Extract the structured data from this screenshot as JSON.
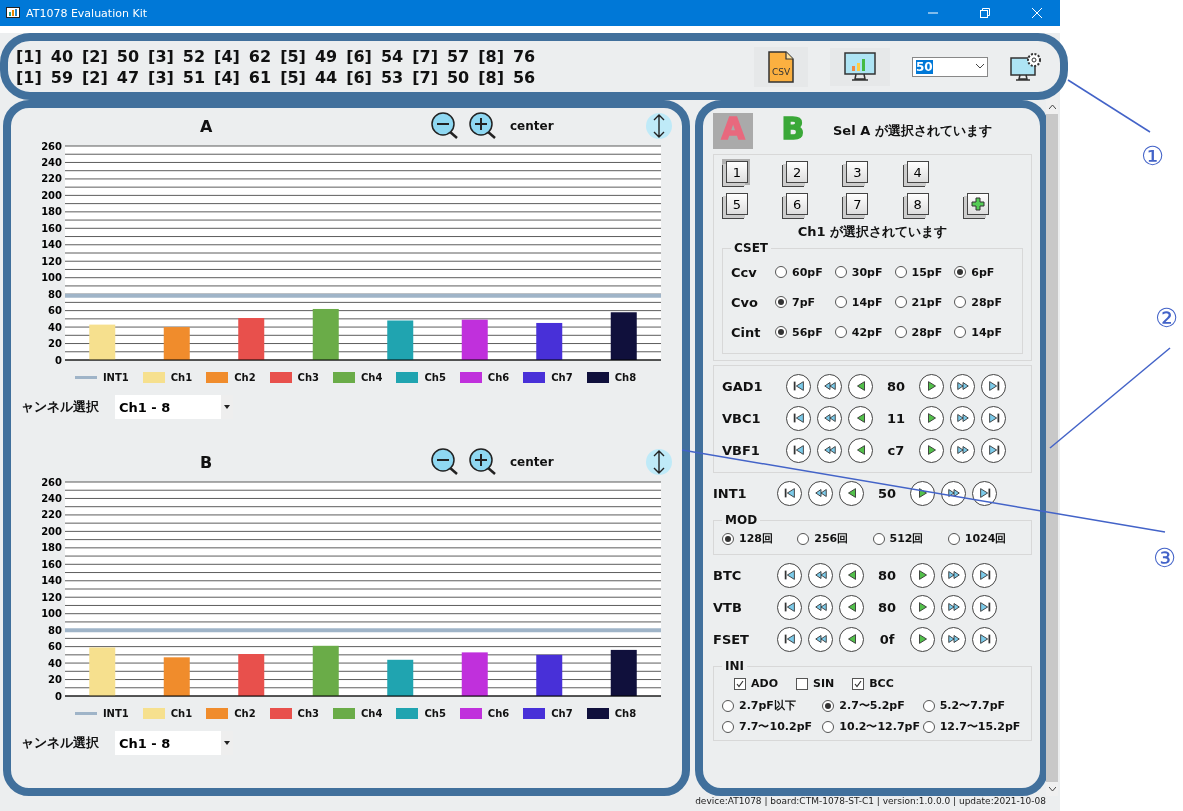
{
  "window": {
    "title": "AT1078 Evaluation Kit"
  },
  "readings": [
    {
      "pairs": [
        {
          "channel": "[1]",
          "value": "40"
        },
        {
          "channel": "[2]",
          "value": "50"
        },
        {
          "channel": "[3]",
          "value": "52"
        },
        {
          "channel": "[4]",
          "value": "62"
        },
        {
          "channel": "[5]",
          "value": "49"
        },
        {
          "channel": "[6]",
          "value": "54"
        },
        {
          "channel": "[7]",
          "value": "57"
        },
        {
          "channel": "[8]",
          "value": "76"
        }
      ]
    },
    {
      "pairs": [
        {
          "channel": "[1]",
          "value": "59"
        },
        {
          "channel": "[2]",
          "value": "47"
        },
        {
          "channel": "[3]",
          "value": "51"
        },
        {
          "channel": "[4]",
          "value": "61"
        },
        {
          "channel": "[5]",
          "value": "44"
        },
        {
          "channel": "[6]",
          "value": "53"
        },
        {
          "channel": "[7]",
          "value": "50"
        },
        {
          "channel": "[8]",
          "value": "56"
        }
      ]
    }
  ],
  "toolbar": {
    "csv_label": "CSV",
    "interval": "50"
  },
  "charts": [
    {
      "title": "A",
      "zoom_label": "center",
      "channel_label": "ャンネル選択",
      "channel_select": "Ch1 - 8",
      "chart_data": {
        "type": "bar",
        "grid": true,
        "ylim": [
          0,
          260
        ],
        "yticks": [
          0,
          20,
          40,
          60,
          80,
          100,
          120,
          140,
          160,
          180,
          200,
          220,
          240,
          260
        ],
        "ref_lines": [
          {
            "axis": "y",
            "value": 78,
            "label": "INT1",
            "color": "#9fb4c8"
          }
        ],
        "series": [
          {
            "name": "Ch1",
            "color": "#f6e08e",
            "values": [
              43,
              null,
              null,
              null,
              null,
              null,
              null,
              null
            ]
          },
          {
            "name": "Ch2",
            "color": "#f08c2c",
            "values": [
              null,
              40,
              null,
              null,
              null,
              null,
              null,
              null
            ]
          },
          {
            "name": "Ch3",
            "color": "#e8504c",
            "values": [
              null,
              null,
              51,
              null,
              null,
              null,
              null,
              null
            ]
          },
          {
            "name": "Ch4",
            "color": "#6aac48",
            "values": [
              null,
              null,
              null,
              62,
              null,
              null,
              null,
              null
            ]
          },
          {
            "name": "Ch5",
            "color": "#20a4b0",
            "values": [
              null,
              null,
              null,
              null,
              48,
              null,
              null,
              null
            ]
          },
          {
            "name": "Ch6",
            "color": "#c030dc",
            "values": [
              null,
              null,
              null,
              null,
              null,
              49,
              null,
              null
            ]
          },
          {
            "name": "Ch7",
            "color": "#4830d8",
            "values": [
              null,
              null,
              null,
              null,
              null,
              null,
              45,
              null
            ]
          },
          {
            "name": "Ch8",
            "color": "#10103c",
            "values": [
              null,
              null,
              null,
              null,
              null,
              null,
              null,
              58
            ]
          }
        ]
      }
    },
    {
      "title": "B",
      "zoom_label": "center",
      "channel_label": "ャンネル選択",
      "channel_select": "Ch1 - 8",
      "chart_data": {
        "type": "bar",
        "grid": true,
        "ylim": [
          0,
          260
        ],
        "yticks": [
          0,
          20,
          40,
          60,
          80,
          100,
          120,
          140,
          160,
          180,
          200,
          220,
          240,
          260
        ],
        "ref_lines": [
          {
            "axis": "y",
            "value": 80,
            "label": "INT1",
            "color": "#9fb4c8"
          }
        ],
        "series": [
          {
            "name": "Ch1",
            "color": "#f6e08e",
            "values": [
              59,
              null,
              null,
              null,
              null,
              null,
              null,
              null
            ]
          },
          {
            "name": "Ch2",
            "color": "#f08c2c",
            "values": [
              null,
              47,
              null,
              null,
              null,
              null,
              null,
              null
            ]
          },
          {
            "name": "Ch3",
            "color": "#e8504c",
            "values": [
              null,
              null,
              51,
              null,
              null,
              null,
              null,
              null
            ]
          },
          {
            "name": "Ch4",
            "color": "#6aac48",
            "values": [
              null,
              null,
              null,
              61,
              null,
              null,
              null,
              null
            ]
          },
          {
            "name": "Ch5",
            "color": "#20a4b0",
            "values": [
              null,
              null,
              null,
              null,
              44,
              null,
              null,
              null
            ]
          },
          {
            "name": "Ch6",
            "color": "#c030dc",
            "values": [
              null,
              null,
              null,
              null,
              null,
              53,
              null,
              null
            ]
          },
          {
            "name": "Ch7",
            "color": "#4830d8",
            "values": [
              null,
              null,
              null,
              null,
              null,
              null,
              50,
              null
            ]
          },
          {
            "name": "Ch8",
            "color": "#10103c",
            "values": [
              null,
              null,
              null,
              null,
              null,
              null,
              null,
              56
            ]
          }
        ]
      }
    }
  ],
  "control": {
    "sel_buttons": [
      {
        "label": "A",
        "color": "#e8697e",
        "selected": true
      },
      {
        "label": "B",
        "color": "#3aa838",
        "selected": false
      }
    ],
    "sel_status": "Sel A が選択されています",
    "channels": [
      {
        "label": "1",
        "selected": true
      },
      {
        "label": "2",
        "selected": false
      },
      {
        "label": "3",
        "selected": false
      },
      {
        "label": "4",
        "selected": false
      },
      {
        "label": "5",
        "selected": false
      },
      {
        "label": "6",
        "selected": false
      },
      {
        "label": "7",
        "selected": false
      },
      {
        "label": "8",
        "selected": false
      }
    ],
    "ch_status": "Ch1 が選択されています",
    "cset": {
      "title": "CSET",
      "rows": [
        {
          "label": "Ccv",
          "options": [
            {
              "label": "60pF",
              "selected": false
            },
            {
              "label": "30pF",
              "selected": false
            },
            {
              "label": "15pF",
              "selected": false
            },
            {
              "label": "6pF",
              "selected": true
            }
          ]
        },
        {
          "label": "Cvo",
          "options": [
            {
              "label": "7pF",
              "selected": true
            },
            {
              "label": "14pF",
              "selected": false
            },
            {
              "label": "21pF",
              "selected": false
            },
            {
              "label": "28pF",
              "selected": false
            }
          ]
        },
        {
          "label": "Cint",
          "options": [
            {
              "label": "56pF",
              "selected": true
            },
            {
              "label": "42pF",
              "selected": false
            },
            {
              "label": "28pF",
              "selected": false
            },
            {
              "label": "14pF",
              "selected": false
            }
          ]
        }
      ]
    },
    "group1": [
      {
        "label": "GAD1",
        "value": "80"
      },
      {
        "label": "VBC1",
        "value": "11"
      },
      {
        "label": "VBF1",
        "value": "c7"
      }
    ],
    "int1": {
      "label": "INT1",
      "value": "50"
    },
    "mod": {
      "title": "MOD",
      "options": [
        {
          "label": "128回",
          "selected": true
        },
        {
          "label": "256回",
          "selected": false
        },
        {
          "label": "512回",
          "selected": false
        },
        {
          "label": "1024回",
          "selected": false
        }
      ]
    },
    "group2": [
      {
        "label": "BTC",
        "value": "80"
      },
      {
        "label": "VTB",
        "value": "80"
      },
      {
        "label": "FSET",
        "value": "0f"
      }
    ],
    "ini": {
      "title": "INI",
      "checks": [
        {
          "label": "ADO",
          "checked": true
        },
        {
          "label": "SIN",
          "checked": false
        },
        {
          "label": "BCC",
          "checked": true
        }
      ],
      "options": [
        {
          "label": "2.7pF以下",
          "selected": false
        },
        {
          "label": "2.7〜5.2pF",
          "selected": true
        },
        {
          "label": "5.2〜7.7pF",
          "selected": false
        },
        {
          "label": "7.7〜10.2pF",
          "selected": false
        },
        {
          "label": "10.2〜12.7pF",
          "selected": false
        },
        {
          "label": "12.7〜15.2pF",
          "selected": false
        }
      ]
    }
  },
  "status_bar": "device:AT1078 | board:CTM-1078-ST-C1 | version:1.0.0.0 | update:2021-10-08",
  "callouts": [
    "①",
    "②",
    "③"
  ]
}
